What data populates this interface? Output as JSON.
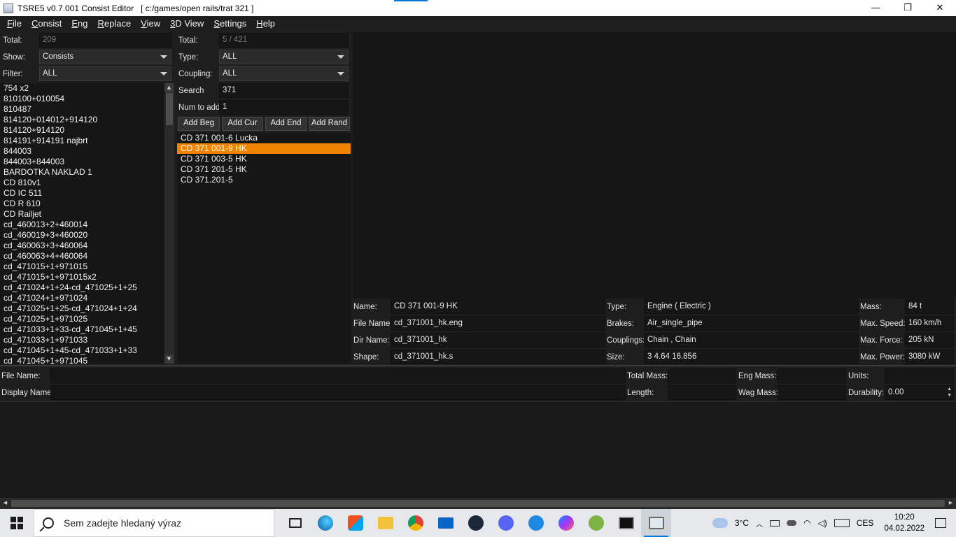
{
  "window": {
    "title": "TSRE5 v0.7.001 Consist Editor   [ c:/games/open rails/trat 321 ]",
    "minimize": "—",
    "maximize": "❐",
    "close": "✕"
  },
  "menu": [
    "File",
    "Consist",
    "Eng",
    "Replace",
    "View",
    "3D View",
    "Settings",
    "Help"
  ],
  "left_panel": {
    "total_label": "Total:",
    "total_value": "209",
    "show_label": "Show:",
    "show_value": "Consists",
    "filter_label": "Filter:",
    "filter_value": "ALL",
    "consists": [
      "754 x2",
      "810100+010054",
      "810487",
      "814120+014012+914120",
      "814120+914120",
      "814191+914191 najbrt",
      "844003",
      "844003+844003",
      "BARDOTKA NAKLAD 1",
      "CD 810v1",
      "CD IC 511",
      "CD R 610",
      "CD Railjet",
      "cd_460013+2+460014",
      "cd_460019+3+460020",
      "cd_460063+3+460064",
      "cd_460063+4+460064",
      "cd_471015+1+971015",
      "cd_471015+1+971015x2",
      "cd_471024+1+24-cd_471025+1+25",
      "cd_471024+1+971024",
      "cd_471025+1+25-cd_471024+1+24",
      "cd_471025+1+971025",
      "cd_471033+1+33-cd_471045+1+45",
      "cd_471033+1+971033",
      "cd_471045+1+45-cd_471033+1+33",
      "cd_471045+1+971045"
    ]
  },
  "mid_panel": {
    "total_label": "Total:",
    "total_value": "5 / 421",
    "type_label": "Type:",
    "type_value": "ALL",
    "coupling_label": "Coupling:",
    "coupling_value": "ALL",
    "search_label": "Search",
    "search_value": "371",
    "num_label": "Num to add",
    "num_value": "1",
    "buttons": [
      "Add Beg",
      "Add Cur",
      "Add End",
      "Add Rand"
    ],
    "engines": [
      "CD 371 001-6 Lucka",
      "CD 371 001-9 HK",
      "CD 371 003-5 HK",
      "CD 371 201-5 HK",
      "CD 371.201-5"
    ],
    "selected_index": 1
  },
  "details": {
    "name_label": "Name:",
    "name": "CD 371 001-9 HK",
    "file_label": "File Name:",
    "file": "cd_371001_hk.eng",
    "dir_label": "Dir Name:",
    "dir": "cd_371001_hk",
    "shape_label": "Shape:",
    "shape": "cd_371001_hk.s",
    "type_label": "Type:",
    "type": "Engine ( Electric )",
    "brakes_label": "Brakes:",
    "brakes": "Air_single_pipe",
    "couplings_label": "Couplings:",
    "couplings": "Chain , Chain",
    "size_label": "Size:",
    "size": "3 4.64 16.856",
    "mass_label": "Mass:",
    "mass": "84 t",
    "speed_label": "Max. Speed:",
    "speed": "160 km/h",
    "force_label": "Max. Force:",
    "force": "205 kN",
    "power_label": "Max. Power:",
    "power": "3080 kW"
  },
  "consist": {
    "file_label": "File Name:",
    "display_label": "Display Name:",
    "total_mass_label": "Total Mass:",
    "length_label": "Length:",
    "eng_mass_label": "Eng Mass:",
    "wag_mass_label": "Wag Mass:",
    "units_label": "Units:",
    "durability_label": "Durability:",
    "durability_value": "0.00"
  },
  "taskbar": {
    "search_placeholder": "Sem zadejte hledaný výraz",
    "weather": "3°C",
    "language": "CES",
    "time": "10:20",
    "date": "04.02.2022"
  },
  "colors": {
    "selection": "#f08300",
    "background": "#1e1e1e",
    "field": "#161616"
  }
}
